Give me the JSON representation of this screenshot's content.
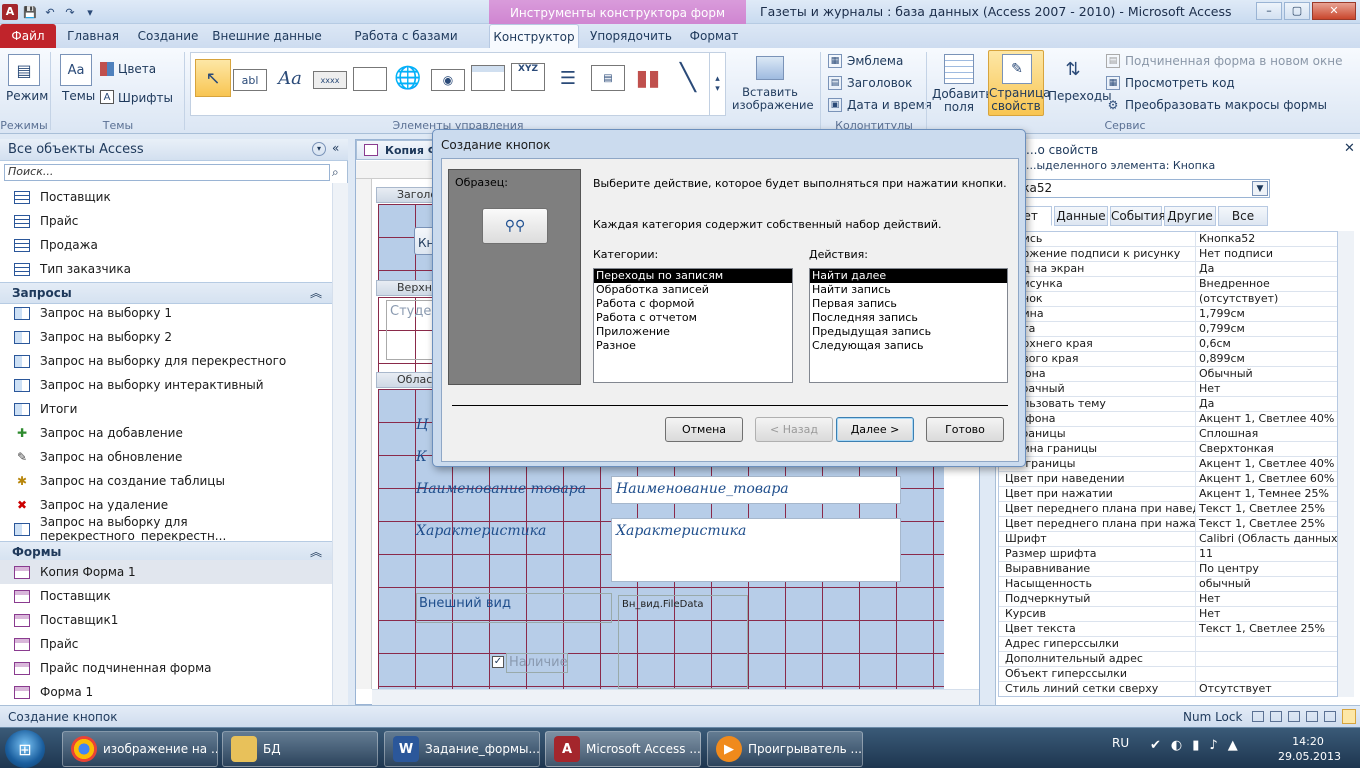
{
  "window": {
    "title": "Газеты и журналы : база данных (Access 2007 - 2010) - Microsoft Access",
    "context_tab": "Инструменты конструктора форм",
    "min": "–",
    "max": "▢",
    "close": "✕"
  },
  "tabs": [
    "Файл",
    "Главная",
    "Создание",
    "Внешние данные",
    "Работа с базами данных",
    "Конструктор",
    "Упорядочить",
    "Формат"
  ],
  "ribbon": {
    "mode_label": "Режим",
    "modes_group": "Режимы",
    "themes_label": "Темы",
    "colors_label": "Цвета",
    "fonts_label": "Шрифты",
    "themes_group": "Темы",
    "controls_group": "Элементы управления",
    "insert_image": "Вставить изображение",
    "logo": "Эмблема",
    "title": "Заголовок",
    "datetime": "Дата и время",
    "header_group": "Колонтитулы",
    "add_fields": "Добавить поля",
    "property_sheet": "Страница свойств",
    "tab_order": "Переходы",
    "subform_new": "Подчиненная форма в новом окне",
    "view_code": "Просмотреть код",
    "convert_macros": "Преобразовать макросы формы",
    "tools_group": "Сервис",
    "ctrl_text": "abl",
    "ctrl_label": "Aa",
    "ctrl_xxxx": "xxxx",
    "ctrl_xyz": "XYZ"
  },
  "nav": {
    "title": "Все объекты Access",
    "search_placeholder": "Поиск...",
    "tables": [
      "Поставщик",
      "Прайс",
      "Продажа",
      "Тип заказчика"
    ],
    "queries_header": "Запросы",
    "queries": [
      "Запрос на выборку 1",
      "Запрос на выборку 2",
      "Запрос на выборку для перекрестного",
      "Запрос на выборку интерактивный",
      "Итоги",
      "Запрос на добавление",
      "Запрос на обновление",
      "Запрос на создание таблицы",
      "Запрос на удаление",
      "Запрос на выборку для перекрестного_перекрестн..."
    ],
    "forms_header": "Формы",
    "forms": [
      "Копия Форма 1",
      "Поставщик",
      "Поставщик1",
      "Прайс",
      "Прайс подчиненная форма",
      "Форма 1"
    ]
  },
  "design": {
    "tab": "Копия Ф",
    "header_bar": "Заголо",
    "page_header_bar": "Верхн",
    "detail_bar": "Област",
    "header_button": "Кн",
    "page_header_text": "Студе",
    "field_name_label": "Наименование товара",
    "field_name_box": "Наименование_товара",
    "field_char_label": "Характеристика",
    "field_char_box": "Характеристика",
    "field_look_label": "Внешний вид",
    "field_look_box": "Вн_вид.FileData",
    "field_avail_label": "Наличие",
    "partial_1": "Ц",
    "partial_2": "К"
  },
  "props": {
    "title": "...о свойств",
    "selection_type": "...ыделенного элемента:  Кнопка",
    "selected": "...пка52",
    "tabs": [
      "...ет",
      "Данные",
      "События",
      "Другие",
      "Все"
    ],
    "rows": [
      [
        "...пись",
        "Кнопка52"
      ],
      [
        "...ложение подписи к рисунку",
        "Нет подписи"
      ],
      [
        "...од на экран",
        "Да"
      ],
      [
        "...рисунка",
        "Внедренное"
      ],
      [
        "...унок",
        "(отсутствует)"
      ],
      [
        "...рина",
        "1,799см"
      ],
      [
        "...ота",
        "0,799см"
      ],
      [
        "...ерхнего края",
        "0,6см"
      ],
      [
        "...евого края",
        "0,899см"
      ],
      [
        "...фона",
        "Обычный"
      ],
      [
        "...зрачный",
        "Нет"
      ],
      [
        "...ользовать тему",
        "Да"
      ],
      [
        "...т фона",
        "Акцент 1, Светлее 40%"
      ],
      [
        "...границы",
        "Сплошная"
      ],
      [
        "...рина границы",
        "Сверхтонкая"
      ],
      [
        "...т границы",
        "Акцент 1, Светлее 40%"
      ],
      [
        "Цвет при наведении",
        "Акцент 1, Светлее 60%"
      ],
      [
        "Цвет при нажатии",
        "Акцент 1, Темнее 25%"
      ],
      [
        "Цвет переднего плана при наведе",
        "Текст 1, Светлее 25%"
      ],
      [
        "Цвет переднего плана при нажатии",
        "Текст 1, Светлее 25%"
      ],
      [
        "Шрифт",
        "Calibri (Область данных)"
      ],
      [
        "Размер шрифта",
        "11"
      ],
      [
        "Выравнивание",
        "По центру"
      ],
      [
        "Насыщенность",
        "обычный"
      ],
      [
        "Подчеркнутый",
        "Нет"
      ],
      [
        "Курсив",
        "Нет"
      ],
      [
        "Цвет текста",
        "Текст 1, Светлее 25%"
      ],
      [
        "Адрес гиперссылки",
        ""
      ],
      [
        "Дополнительный адрес",
        ""
      ],
      [
        "Объект гиперссылки",
        ""
      ],
      [
        "Стиль линий сетки сверху",
        "Отсутствует"
      ]
    ]
  },
  "dialog": {
    "title": "Создание кнопок",
    "sample_label": "Образец:",
    "instruction": "Выберите действие, которое будет выполняться при нажатии кнопки.",
    "info": "Каждая категория содержит собственный набор действий.",
    "categories_label": "Категории:",
    "actions_label": "Действия:",
    "categories": [
      "Переходы по записям",
      "Обработка записей",
      "Работа с формой",
      "Работа с отчетом",
      "Приложение",
      "Разное"
    ],
    "actions": [
      "Найти далее",
      "Найти запись",
      "Первая запись",
      "Последняя запись",
      "Предыдущая запись",
      "Следующая запись"
    ],
    "btn_cancel": "Отмена",
    "btn_back": "< Назад",
    "btn_next": "Далее >",
    "btn_finish": "Готово"
  },
  "status": {
    "text": "Создание кнопок",
    "numlock": "Num Lock"
  },
  "taskbar": {
    "items": [
      "изображение на ...",
      "БД",
      "Задание_формы....",
      "Microsoft Access ...",
      "Проигрыватель ..."
    ],
    "lang": "RU",
    "time": "14:20",
    "date": "29.05.2013"
  }
}
